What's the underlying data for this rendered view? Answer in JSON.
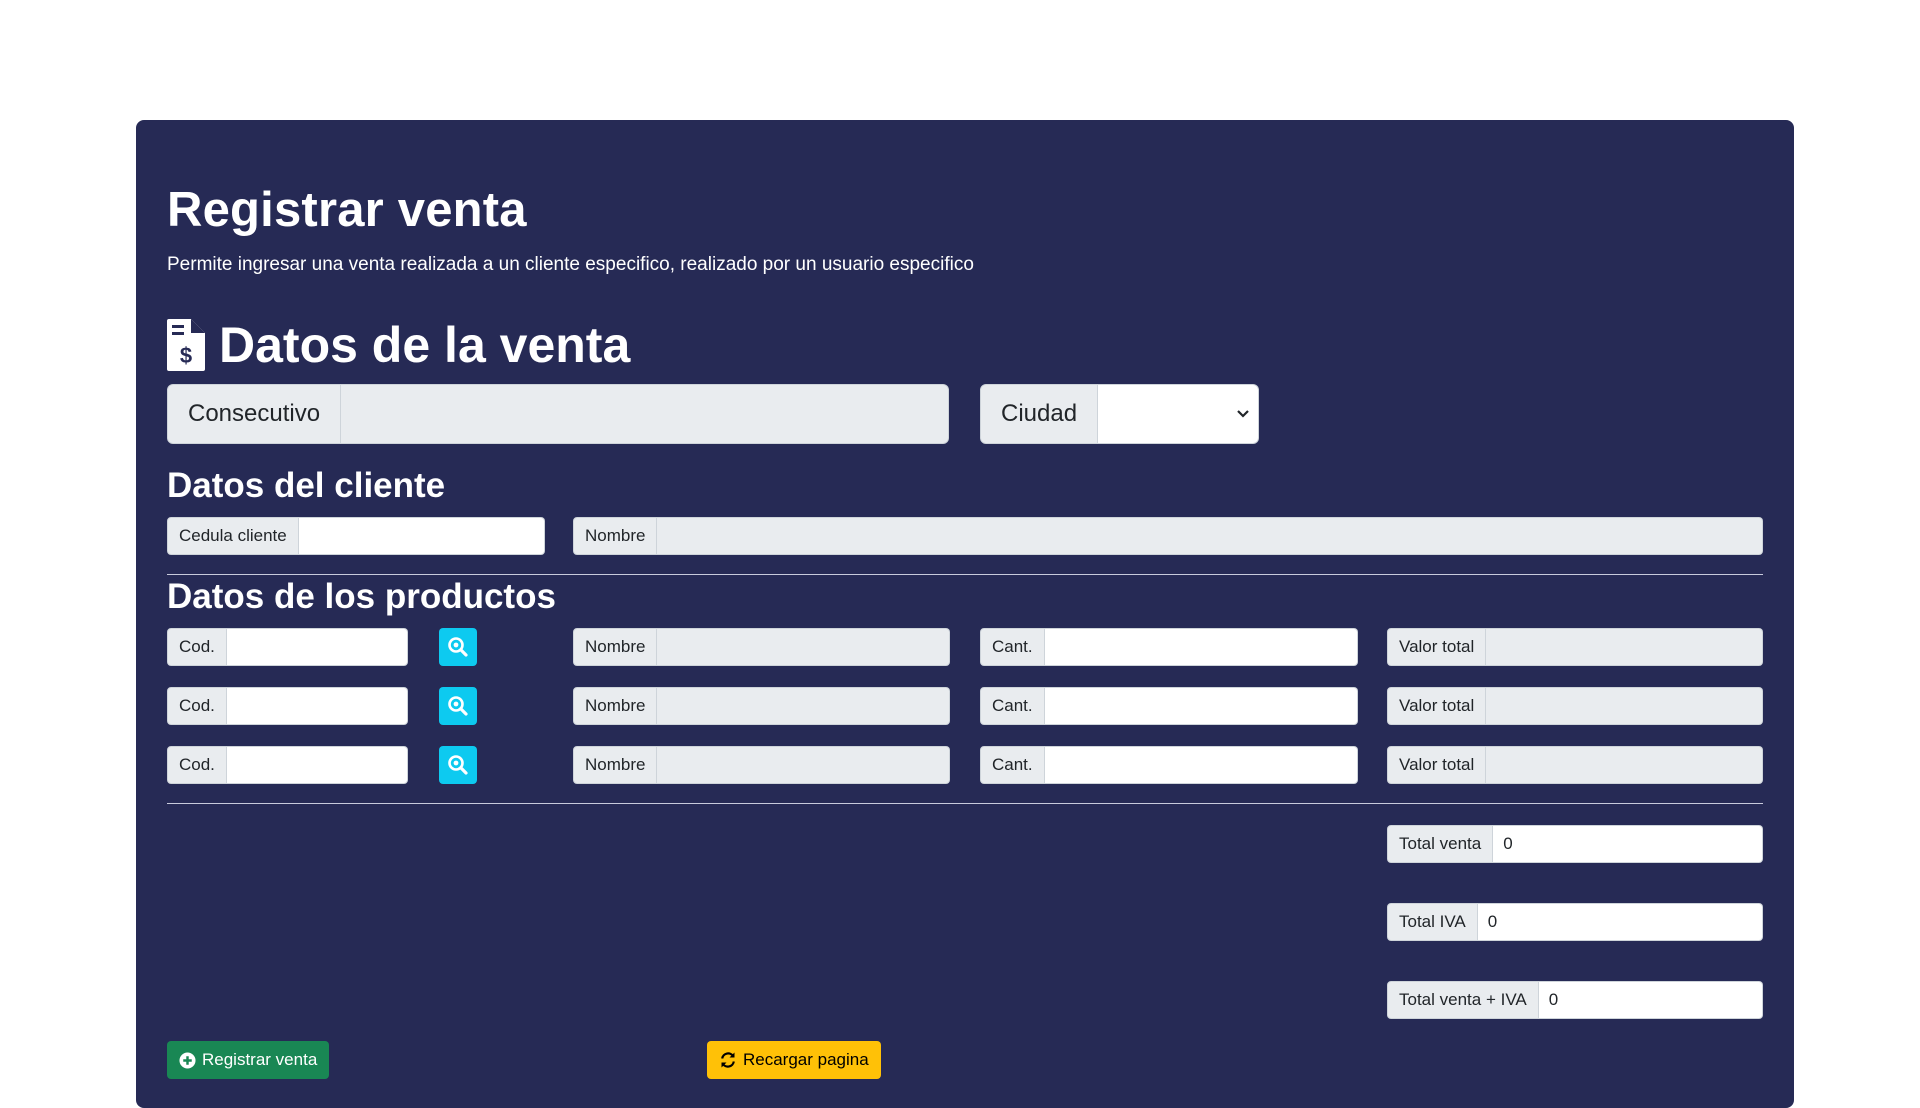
{
  "header": {
    "title": "Registrar venta",
    "subtitle": "Permite ingresar una venta realizada a un cliente especifico, realizado por un usuario especifico"
  },
  "venta": {
    "heading": "Datos de la venta",
    "heading_icon": "file-invoice-dollar-icon",
    "consecutivo_label": "Consecutivo",
    "consecutivo_value": "",
    "ciudad_label": "Ciudad",
    "ciudad_value": ""
  },
  "cliente": {
    "heading": "Datos del cliente",
    "cedula_label": "Cedula cliente",
    "cedula_value": "",
    "nombre_label": "Nombre",
    "nombre_value": ""
  },
  "productos": {
    "heading": "Datos de los productos",
    "rows": [
      {
        "cod_label": "Cod.",
        "cod_value": "",
        "nombre_label": "Nombre",
        "nombre_value": "",
        "cant_label": "Cant.",
        "cant_value": "",
        "valor_label": "Valor total",
        "valor_value": ""
      },
      {
        "cod_label": "Cod.",
        "cod_value": "",
        "nombre_label": "Nombre",
        "nombre_value": "",
        "cant_label": "Cant.",
        "cant_value": "",
        "valor_label": "Valor total",
        "valor_value": ""
      },
      {
        "cod_label": "Cod.",
        "cod_value": "",
        "nombre_label": "Nombre",
        "nombre_value": "",
        "cant_label": "Cant.",
        "cant_value": "",
        "valor_label": "Valor total",
        "valor_value": ""
      }
    ]
  },
  "totales": {
    "total_venta_label": "Total venta",
    "total_venta_value": "0",
    "total_iva_label": "Total IVA",
    "total_iva_value": "0",
    "total_venta_iva_label": "Total venta + IVA",
    "total_venta_iva_value": "0"
  },
  "actions": {
    "registrar_label": "Registrar venta",
    "registrar_icon": "plus-circle-icon",
    "recargar_label": "Recargar pagina",
    "recargar_icon": "refresh-icon"
  },
  "colors": {
    "panel_bg": "#262a55",
    "success": "#198754",
    "warning": "#ffc107",
    "info": "#0dcaf0"
  }
}
